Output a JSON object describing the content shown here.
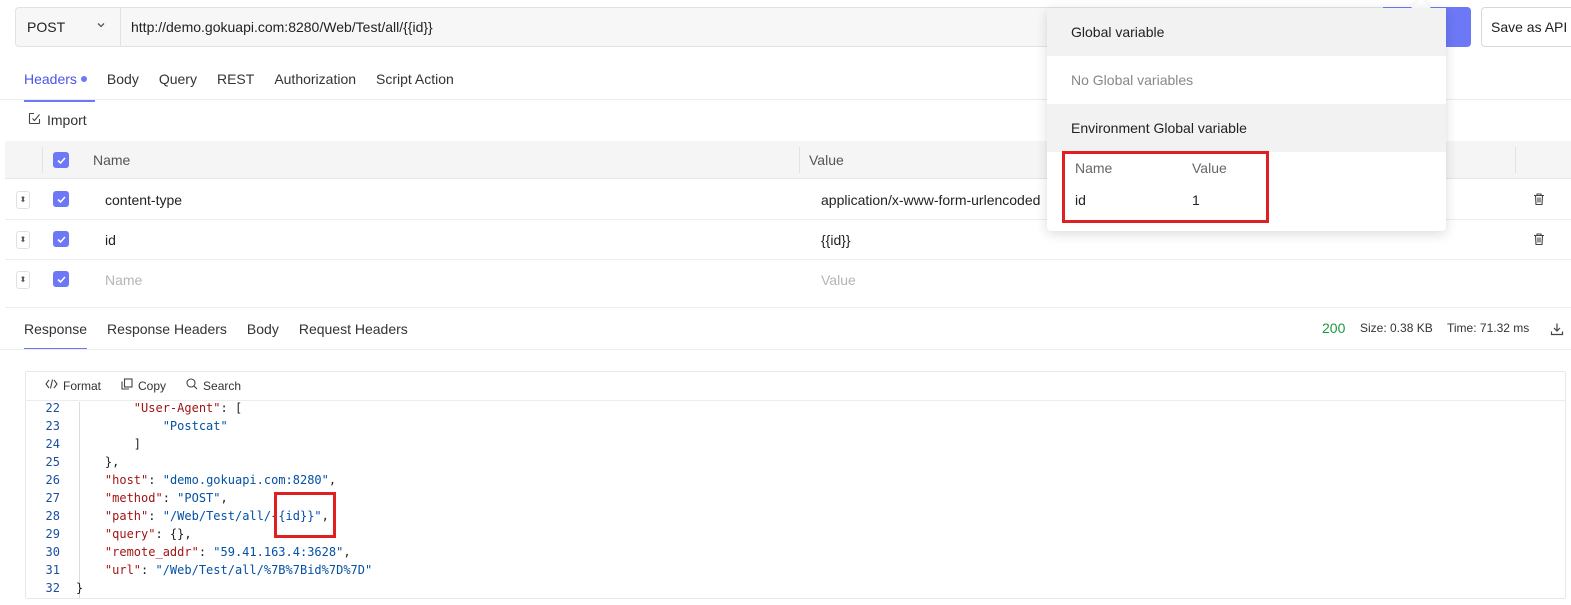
{
  "request": {
    "method": "POST",
    "url": "http://demo.gokuapi.com:8280/Web/Test/all/{{id}}",
    "save_as_api_label": "Save as API"
  },
  "request_tabs": [
    {
      "label": "Headers",
      "active": true,
      "dot": true
    },
    {
      "label": "Body"
    },
    {
      "label": "Query"
    },
    {
      "label": "REST"
    },
    {
      "label": "Authorization"
    },
    {
      "label": "Script Action"
    }
  ],
  "import_label": "Import",
  "headers_table": {
    "columns": [
      "Name",
      "Value"
    ],
    "rows": [
      {
        "name": "content-type",
        "value": "application/x-www-form-urlencoded",
        "checked": true
      },
      {
        "name": "id",
        "value": "{{id}}",
        "checked": true
      }
    ],
    "placeholder_row": {
      "name_placeholder": "Name",
      "value_placeholder": "Value",
      "checked": true
    }
  },
  "response_tabs": [
    {
      "label": "Response",
      "active": true
    },
    {
      "label": "Response Headers"
    },
    {
      "label": "Body"
    },
    {
      "label": "Request Headers"
    }
  ],
  "response_status": {
    "code": "200",
    "size": "Size: 0.38 KB",
    "time": "Time: 71.32 ms"
  },
  "code_toolbar": {
    "format_label": "Format",
    "copy_label": "Copy",
    "search_label": "Search"
  },
  "code_lines": [
    {
      "n": "22",
      "indent": "        ",
      "key": "\"User-Agent\"",
      "rest": ": ["
    },
    {
      "n": "23",
      "indent": "            ",
      "str": "\"Postcat\""
    },
    {
      "n": "24",
      "indent": "        ",
      "rest": "]"
    },
    {
      "n": "25",
      "indent": "    ",
      "rest": "},"
    },
    {
      "n": "26",
      "indent": "    ",
      "key": "\"host\"",
      "rest": ": ",
      "str": "\"demo.gokuapi.com:8280\"",
      "tail": ","
    },
    {
      "n": "27",
      "indent": "    ",
      "key": "\"method\"",
      "rest": ": ",
      "str": "\"POST\"",
      "tail": ","
    },
    {
      "n": "28",
      "indent": "    ",
      "key": "\"path\"",
      "rest": ": ",
      "str": "\"/Web/Test/all/{{id}}\"",
      "tail": ","
    },
    {
      "n": "29",
      "indent": "    ",
      "key": "\"query\"",
      "rest": ": {},"
    },
    {
      "n": "30",
      "indent": "    ",
      "key": "\"remote_addr\"",
      "rest": ": ",
      "str": "\"59.41.163.4:3628\"",
      "tail": ","
    },
    {
      "n": "31",
      "indent": "    ",
      "key": "\"url\"",
      "rest": ": ",
      "str": "\"/Web/Test/all/%7B%7Bid%7D%7D\""
    },
    {
      "n": "32",
      "indent": "",
      "rest": "}"
    }
  ],
  "variable_dropdown": {
    "global_title": "Global variable",
    "global_empty": "No Global variables",
    "env_title": "Environment Global variable",
    "env_columns": [
      "Name",
      "Value"
    ],
    "env_rows": [
      {
        "name": "id",
        "value": "1"
      }
    ]
  },
  "colors": {
    "accent": "#6d78f6",
    "status_ok": "#1a9a3f",
    "highlight_box": "#e02020"
  },
  "icons": {
    "method_chevron": "chevron-down-icon",
    "import": "import-icon",
    "row_handle": "sort-handle-icon",
    "row_delete": "trash-icon",
    "download": "download-icon",
    "format": "code-icon",
    "copy": "copy-icon",
    "search": "search-icon"
  }
}
